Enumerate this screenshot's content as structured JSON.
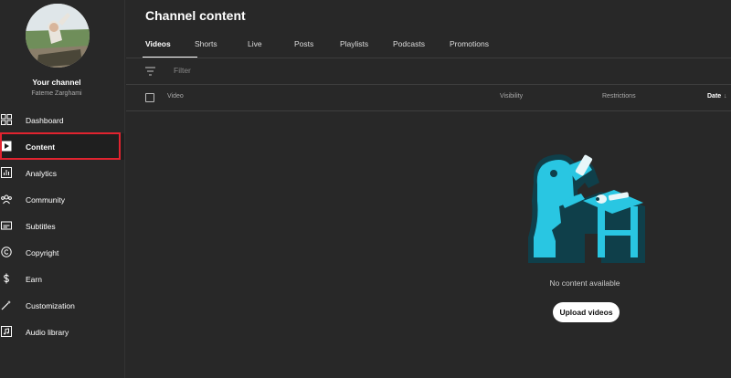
{
  "sidebar": {
    "channel_title": "Your channel",
    "channel_name": "Fateme Zarghami",
    "items": [
      {
        "label": "Dashboard",
        "icon": "dashboard-icon"
      },
      {
        "label": "Content",
        "icon": "content-icon",
        "active": true
      },
      {
        "label": "Analytics",
        "icon": "analytics-icon"
      },
      {
        "label": "Community",
        "icon": "community-icon"
      },
      {
        "label": "Subtitles",
        "icon": "subtitles-icon"
      },
      {
        "label": "Copyright",
        "icon": "copyright-icon"
      },
      {
        "label": "Earn",
        "icon": "earn-icon"
      },
      {
        "label": "Customization",
        "icon": "customization-icon"
      },
      {
        "label": "Audio library",
        "icon": "audio-library-icon"
      }
    ]
  },
  "main": {
    "title": "Channel content",
    "tabs": [
      "Videos",
      "Shorts",
      "Live",
      "Posts",
      "Playlists",
      "Podcasts",
      "Promotions"
    ],
    "active_tab": "Videos",
    "filter": {
      "placeholder": "Filter"
    },
    "table_headers": {
      "video": "Video",
      "visibility": "Visibility",
      "restrictions": "Restrictions",
      "date": "Date"
    },
    "empty_text": "No content available",
    "upload_label": "Upload videos"
  },
  "colors": {
    "background": "#282828",
    "active_highlight": "#e1232f",
    "illustration": "#2bc8e4"
  }
}
